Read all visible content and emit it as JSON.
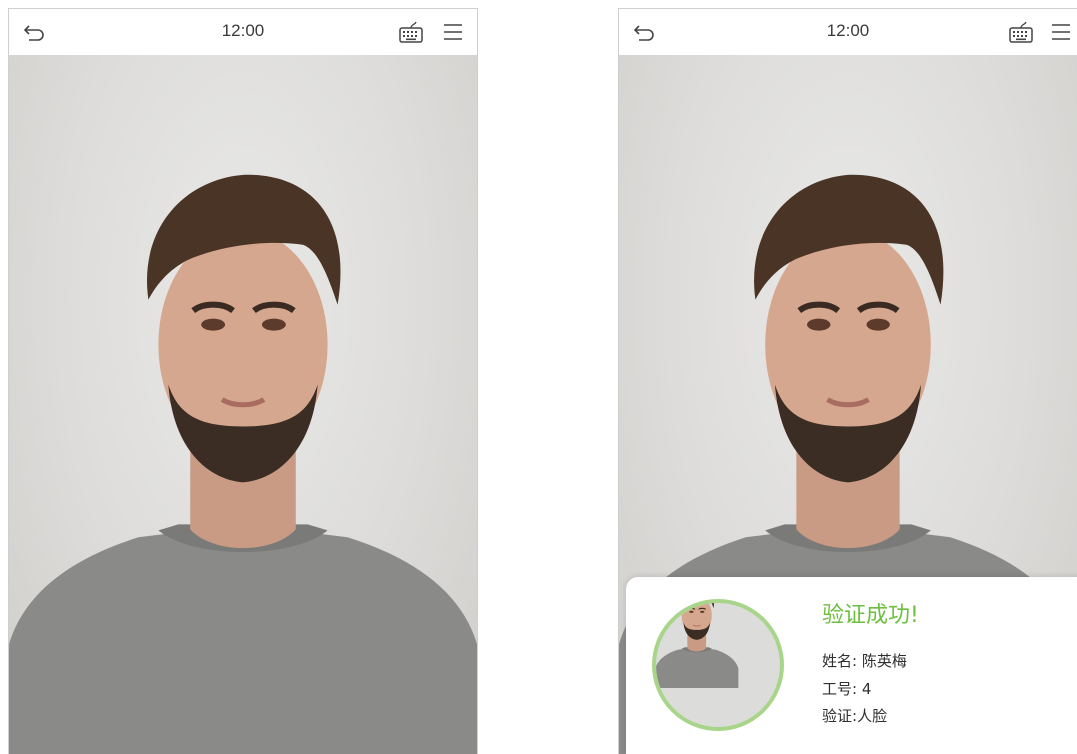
{
  "screens": [
    {
      "time": "12:00"
    },
    {
      "time": "12:00"
    }
  ],
  "icons": {
    "back": "back-arrow-icon",
    "keyboard": "keyboard-icon",
    "menu": "hamburger-menu-icon"
  },
  "result": {
    "title": "验证成功!",
    "name_label": "姓名:",
    "name_value": "陈英梅",
    "id_label": "工号:",
    "id_value": "4",
    "mode_label": "验证:",
    "mode_value": "人脸"
  },
  "colors": {
    "success_green": "#6cbf3f",
    "avatar_ring": "#a9d58b"
  }
}
